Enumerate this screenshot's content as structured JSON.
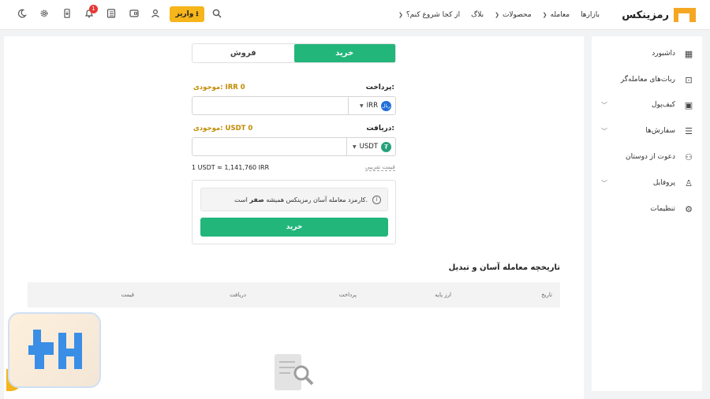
{
  "header": {
    "logo_text": "رمزینکس",
    "nav": [
      {
        "label": "بازارها",
        "chevron": false
      },
      {
        "label": "معامله",
        "chevron": true
      },
      {
        "label": "محصولات",
        "chevron": true
      },
      {
        "label": "بلاگ",
        "chevron": false
      },
      {
        "label": "از کجا شروع کنم؟",
        "chevron": true
      }
    ],
    "deposit_label": "واریز",
    "notification_count": "1"
  },
  "sidebar": {
    "items": [
      {
        "label": "داشبورد",
        "icon": "grid-icon",
        "chevron": false
      },
      {
        "label": "ربات‌های معامله‌گر",
        "icon": "robot-icon",
        "chevron": false
      },
      {
        "label": "کیف‌پول",
        "icon": "wallet-icon",
        "chevron": true
      },
      {
        "label": "سفارش‌ها",
        "icon": "orders-icon",
        "chevron": true
      },
      {
        "label": "دعوت از دوستان",
        "icon": "add-user-icon",
        "chevron": false
      },
      {
        "label": "پروفایل",
        "icon": "user-icon",
        "chevron": true
      },
      {
        "label": "تنظیمات",
        "icon": "gear-icon",
        "chevron": false
      }
    ]
  },
  "trade": {
    "tab_buy": "خرید",
    "tab_sell": "فروش",
    "pay_label": "پرداخت:",
    "pay_balance": "موجودی: IRR 0",
    "pay_currency": "IRR",
    "pay_coin_text": "ریال",
    "receive_label": "دریافت:",
    "receive_balance": "موجودی: USDT 0",
    "receive_currency": "USDT",
    "receive_coin_text": "₮",
    "rate": "1 USDT ≈ 1,141,760 IRR",
    "approx_label": "قیمت تقریبی",
    "note_pre": "کارمزد معامله آسان رمزینکس همیشه ",
    "note_bold": "صفر",
    "note_post": " است.",
    "buy_button": "خرید"
  },
  "history": {
    "title": "تاریخچه معامله آسان و تبدیل",
    "columns": [
      "تاریخ",
      "ارز پایه",
      "پرداخت",
      "دریافت",
      "قیمت"
    ]
  },
  "colors": {
    "accent": "#22b67a",
    "brand": "#f5b51b",
    "balance": "#c08a00"
  }
}
